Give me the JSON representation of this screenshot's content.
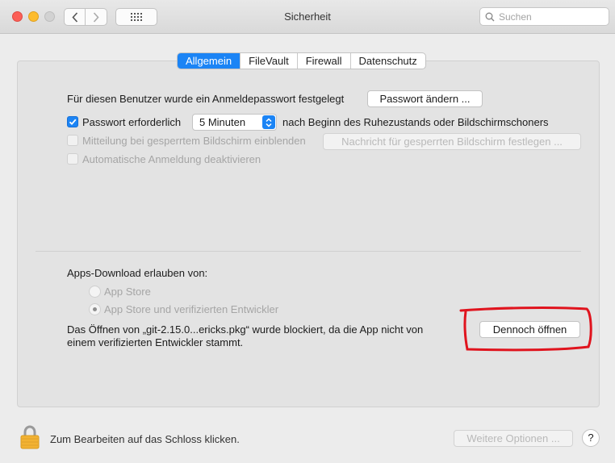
{
  "window": {
    "title": "Sicherheit"
  },
  "search": {
    "placeholder": "Suchen"
  },
  "tabs": [
    {
      "label": "Allgemein"
    },
    {
      "label": "FileVault"
    },
    {
      "label": "Firewall"
    },
    {
      "label": "Datenschutz"
    }
  ],
  "general": {
    "password_text": "Für diesen Benutzer wurde ein Anmeldepasswort festgelegt",
    "change_password_button": "Passwort ändern ...",
    "require_password_label": "Passwort erforderlich",
    "require_password_checked": true,
    "delay_select_value": "5 Minuten",
    "after_text": "nach Beginn des Ruhezustands oder Bildschirmschoners",
    "lock_message_label": "Mitteilung bei gesperrtem Bildschirm einblenden",
    "lock_message_button": "Nachricht für gesperrten Bildschirm festlegen ...",
    "auto_login_label": "Automatische Anmeldung deaktivieren"
  },
  "downloads": {
    "heading": "Apps-Download erlauben von:",
    "options": [
      {
        "label": "App Store",
        "selected": false
      },
      {
        "label": "App Store und verifizierten Entwickler",
        "selected": true
      }
    ],
    "blocked_line1": "Das Öffnen von „git-2.15.0...ericks.pkg“ wurde blockiert, da die App nicht von",
    "blocked_line2": "einem verifizierten Entwickler stammt.",
    "open_anyway_button": "Dennoch öffnen"
  },
  "footer": {
    "lock_text": "Zum Bearbeiten auf das Schloss klicken.",
    "advanced_button": "Weitere Optionen ...",
    "help_label": "?"
  },
  "colors": {
    "accent": "#1b84f5",
    "annotation": "#e0141e"
  }
}
